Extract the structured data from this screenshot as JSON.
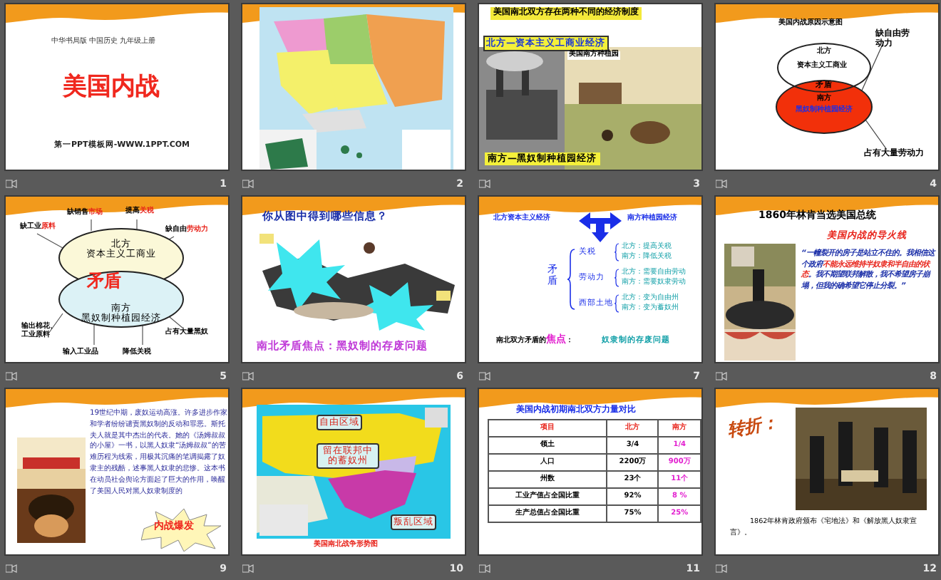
{
  "slides": [
    {
      "number": "1",
      "kind": "title",
      "subtitle": "中华书局版  中国历史  九年级上册",
      "title": "美国内战",
      "footer": "第一PPT模板网-WWW.1PPT.COM"
    },
    {
      "number": "2",
      "kind": "map"
    },
    {
      "number": "3",
      "kind": "economy",
      "title": "美国南北双方存在两种不同的经济制度",
      "north": "北方—资本主义工商业经济",
      "photo_label": "美国南方种植园",
      "south": "南方—黑奴制种植园经济"
    },
    {
      "number": "4",
      "kind": "cause",
      "title": "美国内战原因示意图",
      "north": "北方",
      "north_economy": "资本主义工商业",
      "conflict": "矛盾",
      "south": "南方",
      "south_economy": "黑奴制种植园经济",
      "north_need": "缺自由劳动力",
      "south_has": "占有大量劳动力"
    },
    {
      "number": "5",
      "kind": "conflict",
      "north": "北方",
      "north_economy": "资本主义工商业",
      "conflict": "矛盾",
      "south": "南方",
      "south_economy": "黑奴制种植园经济",
      "labels": [
        {
          "parts": [
            {
              "text": "缺工业",
              "accent": false
            },
            {
              "text": "原料",
              "accent": true
            }
          ]
        },
        {
          "parts": [
            {
              "text": "缺销售",
              "accent": false
            },
            {
              "text": "市场",
              "accent": true
            }
          ]
        },
        {
          "parts": [
            {
              "text": "提高",
              "accent": false
            },
            {
              "text": "关税",
              "accent": true
            }
          ]
        },
        {
          "parts": [
            {
              "text": "缺自由",
              "accent": false
            },
            {
              "text": "劳动力",
              "accent": true
            }
          ]
        },
        {
          "parts": [
            {
              "text": "输出棉花、工业原料",
              "accent": false
            }
          ]
        },
        {
          "parts": [
            {
              "text": "输入工业品",
              "accent": false
            }
          ]
        },
        {
          "parts": [
            {
              "text": "降低关税",
              "accent": false
            }
          ]
        },
        {
          "parts": [
            {
              "text": "占有大量黑奴",
              "accent": false
            }
          ]
        }
      ]
    },
    {
      "number": "6",
      "kind": "cartoon",
      "question": "你从图中得到哪些信息？",
      "caption": "南北矛盾焦点：黑奴制的存废问题"
    },
    {
      "number": "7",
      "kind": "brace",
      "north": "北方资本主义经济",
      "south": "南方种植园经济",
      "conflict": "矛盾",
      "issues": [
        {
          "name": "关税",
          "sides": [
            "北方：提高关税",
            "南方：降低关税"
          ]
        },
        {
          "name": "劳动力",
          "sides": [
            "北方：需要自由劳动",
            "南方：需要奴隶劳动"
          ]
        },
        {
          "name": "西部土地",
          "sides": [
            "北方：变为自由州",
            "南方：变为蓄奴州"
          ]
        }
      ],
      "focus_prefix": "南北双方矛盾的",
      "focus_word": "焦点",
      "focus_colon": "：",
      "focus_answer": "奴隶制的存废问题"
    },
    {
      "number": "8",
      "kind": "quote",
      "title": "1860年林肯当选美国总统",
      "subtitle": "美国内战的导火线",
      "quote": [
        {
          "text": "“一幢裂开的房子是站立不住的。我相信这个政府",
          "accent": false
        },
        {
          "text": "不能永远维持半奴隶和半自由的状态",
          "accent": true
        },
        {
          "text": "。我不期望联邦解散，我不希望房子崩塌，但我的确希望它停止分裂。”",
          "accent": false
        }
      ]
    },
    {
      "number": "9",
      "kind": "novel",
      "text": "19世纪中期，废奴运动高涨。许多进步作家和学者纷纷谴责黑奴制的反动和罪恶。斯托夫人就是其中杰出的代表。她的《汤姆叔叔的小屋》一书，以黑人奴隶“汤姆叔叔”的苦难历程为线索，用极其沉痛的笔调揭露了奴隶主的残酷，述事黑人奴隶的悲惨。这本书在动员社会舆论方面起了巨大的作用，唤醒了美国人民对黑人奴隶制度的",
      "burst": "内战爆发"
    },
    {
      "number": "10",
      "kind": "warmap",
      "callouts": [
        "自由区域",
        "留在联邦中的蓄奴州",
        "叛乱区域"
      ],
      "caption": "美国南北战争形势图"
    },
    {
      "number": "11",
      "kind": "table",
      "title": "美国内战初期南北双方力量对比",
      "columns": [
        "项目",
        "北方",
        "南方"
      ],
      "rows": [
        [
          "领土",
          "3/4",
          "1/4"
        ],
        [
          "人口",
          "2200万",
          "900万"
        ],
        [
          "州数",
          "23个",
          "11个"
        ],
        [
          "工业产值占全国比重",
          "92%",
          "8 %"
        ],
        [
          "生产总值占全国比重",
          "75%",
          "25%"
        ]
      ]
    },
    {
      "number": "12",
      "kind": "turning",
      "heading": "转折：",
      "caption": "1862年林肯政府颁布《宅地法》和《解放黑人奴隶宣言》。"
    }
  ]
}
